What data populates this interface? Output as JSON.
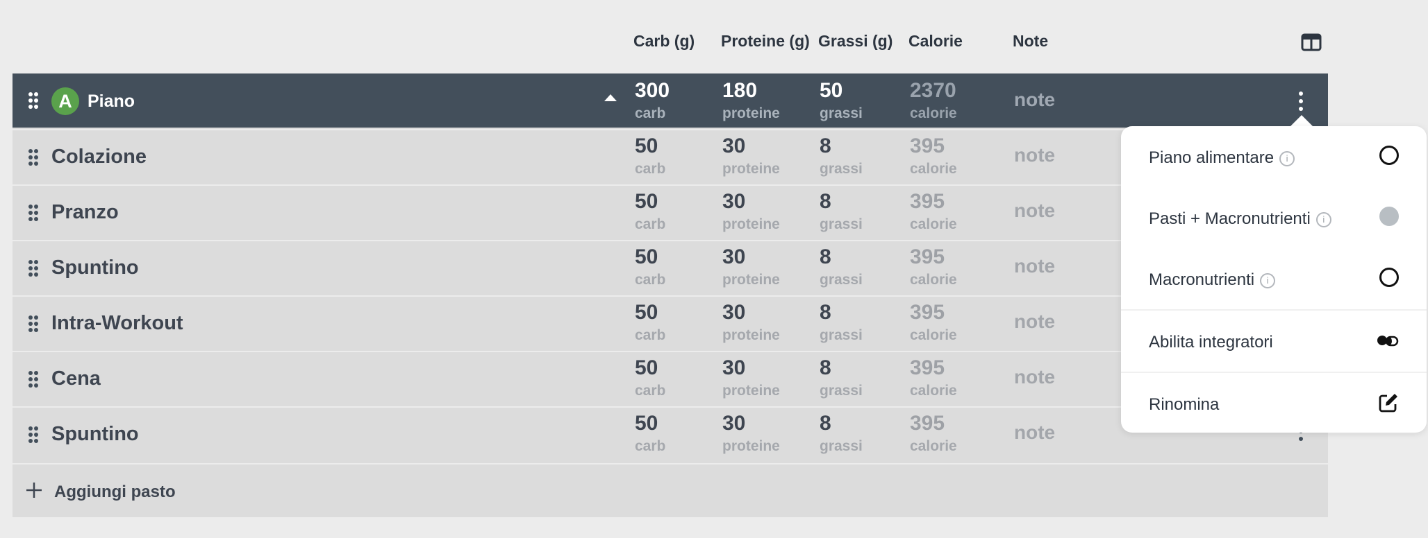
{
  "header": {
    "columns": [
      "Carb (g)",
      "Proteine (g)",
      "Grassi (g)",
      "Calorie",
      "Note"
    ],
    "layout_icon": "columns-layout-icon"
  },
  "plan": {
    "badge": "A",
    "name": "Piano",
    "carb": "300",
    "carb_unit": "carb",
    "protein": "180",
    "protein_unit": "proteine",
    "fat": "50",
    "fat_unit": "grassi",
    "cal": "2370",
    "cal_unit": "calorie",
    "note": "note"
  },
  "meals": [
    {
      "name": "Colazione",
      "carb": "50",
      "carb_unit": "carb",
      "protein": "30",
      "protein_unit": "proteine",
      "fat": "8",
      "fat_unit": "grassi",
      "cal": "395",
      "cal_unit": "calorie",
      "note": "note"
    },
    {
      "name": "Pranzo",
      "carb": "50",
      "carb_unit": "carb",
      "protein": "30",
      "protein_unit": "proteine",
      "fat": "8",
      "fat_unit": "grassi",
      "cal": "395",
      "cal_unit": "calorie",
      "note": "note"
    },
    {
      "name": "Spuntino",
      "carb": "50",
      "carb_unit": "carb",
      "protein": "30",
      "protein_unit": "proteine",
      "fat": "8",
      "fat_unit": "grassi",
      "cal": "395",
      "cal_unit": "calorie",
      "note": "note"
    },
    {
      "name": "Intra-Workout",
      "carb": "50",
      "carb_unit": "carb",
      "protein": "30",
      "protein_unit": "proteine",
      "fat": "8",
      "fat_unit": "grassi",
      "cal": "395",
      "cal_unit": "calorie",
      "note": "note"
    },
    {
      "name": "Cena",
      "carb": "50",
      "carb_unit": "carb",
      "protein": "30",
      "protein_unit": "proteine",
      "fat": "8",
      "fat_unit": "grassi",
      "cal": "395",
      "cal_unit": "calorie",
      "note": "note"
    },
    {
      "name": "Spuntino",
      "carb": "50",
      "carb_unit": "carb",
      "protein": "30",
      "protein_unit": "proteine",
      "fat": "8",
      "fat_unit": "grassi",
      "cal": "395",
      "cal_unit": "calorie",
      "note": "note"
    }
  ],
  "add_meal": {
    "label": "Aggiungi pasto",
    "icon": "plus-icon"
  },
  "menu": {
    "items": [
      {
        "label": "Piano alimentare",
        "info": "i",
        "control": "radio",
        "selected": false
      },
      {
        "label": "Pasti + Macronutrienti",
        "info": "i",
        "control": "radio",
        "selected": true
      },
      {
        "label": "Macronutrienti",
        "info": "i",
        "control": "radio",
        "selected": false
      },
      {
        "label": "Abilita integratori",
        "control": "pills-icon"
      },
      {
        "label": "Rinomina",
        "control": "edit-icon"
      }
    ]
  },
  "colors": {
    "plan_row": "#434f5b",
    "badge": "#5aa24c",
    "table_bg": "#dcdcdc",
    "page_bg": "#ececec"
  }
}
